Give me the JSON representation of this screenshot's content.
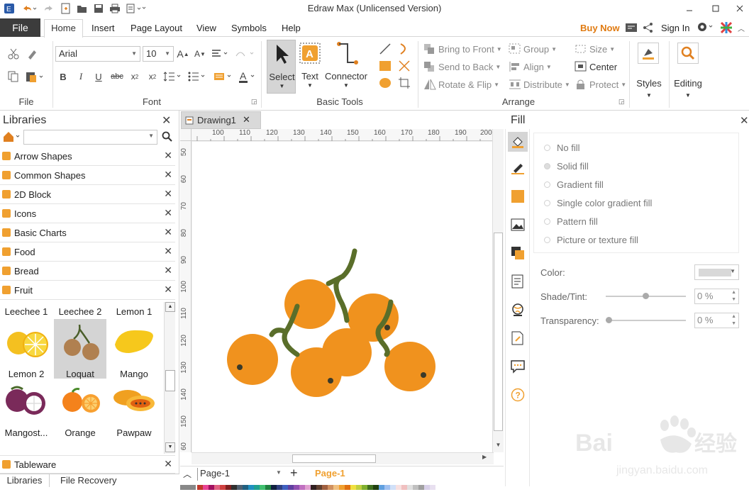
{
  "app": {
    "title": "Edraw Max (Unlicensed Version)",
    "buy_now": "Buy Now",
    "sign_in": "Sign In",
    "window_controls": [
      "minimize-icon",
      "restore-icon",
      "close-icon"
    ]
  },
  "menu_tabs": [
    "File",
    "Home",
    "Insert",
    "Page Layout",
    "View",
    "Symbols",
    "Help"
  ],
  "ribbon": {
    "file_group": "File",
    "font_group": "Font",
    "font_name": "Arial",
    "font_size": "10",
    "basic_tools_group": "Basic Tools",
    "select_label": "Select",
    "text_label": "Text",
    "connector_label": "Connector",
    "arrange_group": "Arrange",
    "bring_to_front": "Bring to Front",
    "send_to_back": "Send to Back",
    "rotate_flip": "Rotate & Flip",
    "group": "Group",
    "align": "Align",
    "distribute": "Distribute",
    "size": "Size",
    "center": "Center",
    "protect": "Protect",
    "styles": "Styles",
    "editing": "Editing"
  },
  "libraries": {
    "title": "Libraries",
    "search_placeholder": "",
    "items": [
      "Arrow Shapes",
      "Common Shapes",
      "2D Block",
      "Icons",
      "Basic Charts",
      "Food",
      "Bread",
      "Fruit"
    ],
    "bottom_item": "Tableware",
    "tabs": [
      "Libraries",
      "File Recovery"
    ]
  },
  "fruit_shapes": [
    {
      "name": "Leechee 1"
    },
    {
      "name": "Leechee 2"
    },
    {
      "name": "Lemon 1"
    },
    {
      "name": "Lemon 2"
    },
    {
      "name": "Loquat"
    },
    {
      "name": "Mango"
    },
    {
      "name": "Mangost..."
    },
    {
      "name": "Orange"
    },
    {
      "name": "Pawpaw"
    }
  ],
  "document": {
    "tab_name": "Drawing1",
    "page_name": "Page-1",
    "active_page": "Page-1",
    "ruler_top": [
      "100",
      "110",
      "120",
      "130",
      "140",
      "150",
      "160",
      "170",
      "180",
      "190",
      "200"
    ],
    "ruler_left": [
      "50",
      "60",
      "70",
      "80",
      "90",
      "100",
      "110",
      "120",
      "130",
      "140",
      "150",
      "60"
    ]
  },
  "fill_panel": {
    "title": "Fill",
    "options": [
      "No fill",
      "Solid fill",
      "Gradient fill",
      "Single color gradient fill",
      "Pattern fill",
      "Picture or texture fill"
    ],
    "color_label": "Color:",
    "shade_label": "Shade/Tint:",
    "shade_value": "0 %",
    "transparency_label": "Transparency:",
    "transparency_value": "0 %"
  },
  "watermark": "Bai du 经验 jingyan.baidu.com",
  "colors": {
    "orange": "#f0921e",
    "stem": "#5a6e2a",
    "accent": "#e8a020"
  }
}
